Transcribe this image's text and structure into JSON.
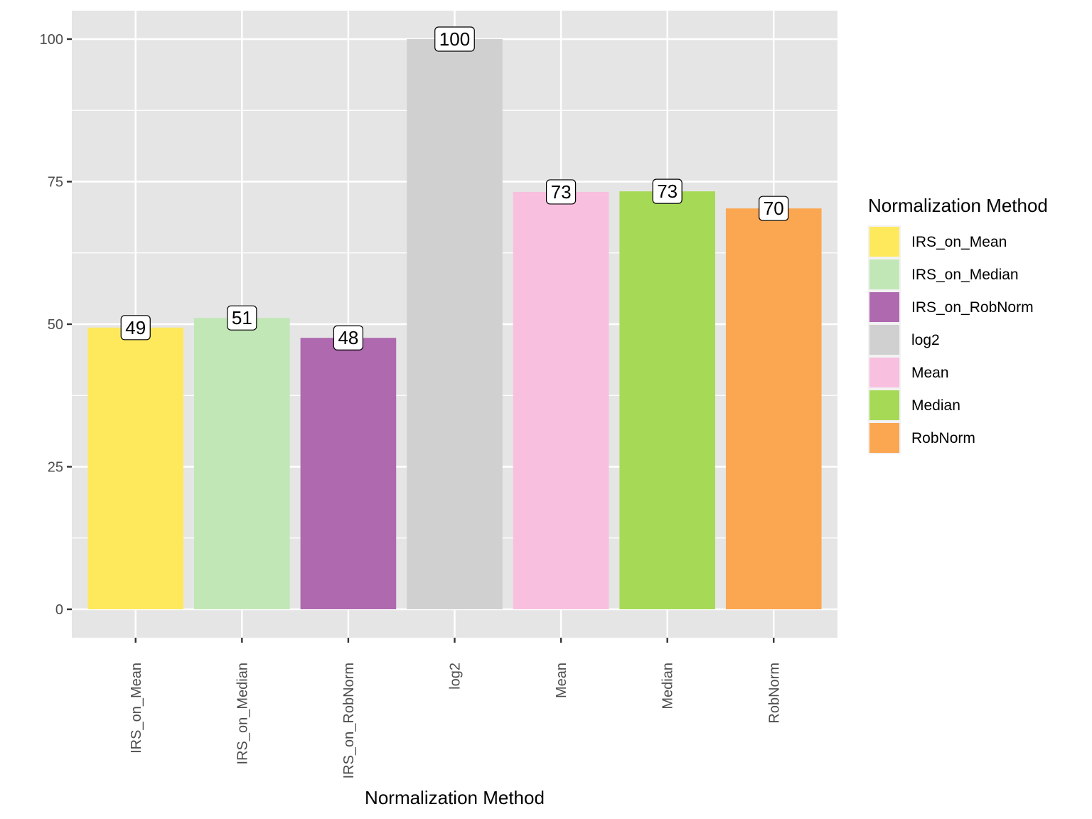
{
  "chart_data": {
    "type": "bar",
    "title": "",
    "xlabel": "Normalization Method",
    "ylabel": "",
    "categories": [
      "IRS_on_Mean",
      "IRS_on_Median",
      "IRS_on_RobNorm",
      "log2",
      "Mean",
      "Median",
      "RobNorm"
    ],
    "values": [
      49.4,
      51.1,
      47.6,
      100,
      73.2,
      73.3,
      70.3
    ],
    "data_labels": [
      "49",
      "51",
      "48",
      "100",
      "73",
      "73",
      "70"
    ],
    "colors": [
      "#FEE95C",
      "#C2E7B7",
      "#AE69AF",
      "#D0D0D0",
      "#F8BFDF",
      "#A6DA56",
      "#FBA651"
    ],
    "ylim": [
      -5,
      104.8
    ],
    "yticks": [
      0,
      25,
      50,
      75,
      100
    ],
    "ytick_labels": [
      "0",
      "25",
      "50",
      "75",
      "100"
    ],
    "grid": true,
    "panel_background": "#E5E5E5",
    "legend": {
      "title": "Normalization Method",
      "position": "right",
      "entries": [
        "IRS_on_Mean",
        "IRS_on_Median",
        "IRS_on_RobNorm",
        "log2",
        "Mean",
        "Median",
        "RobNorm"
      ]
    }
  }
}
